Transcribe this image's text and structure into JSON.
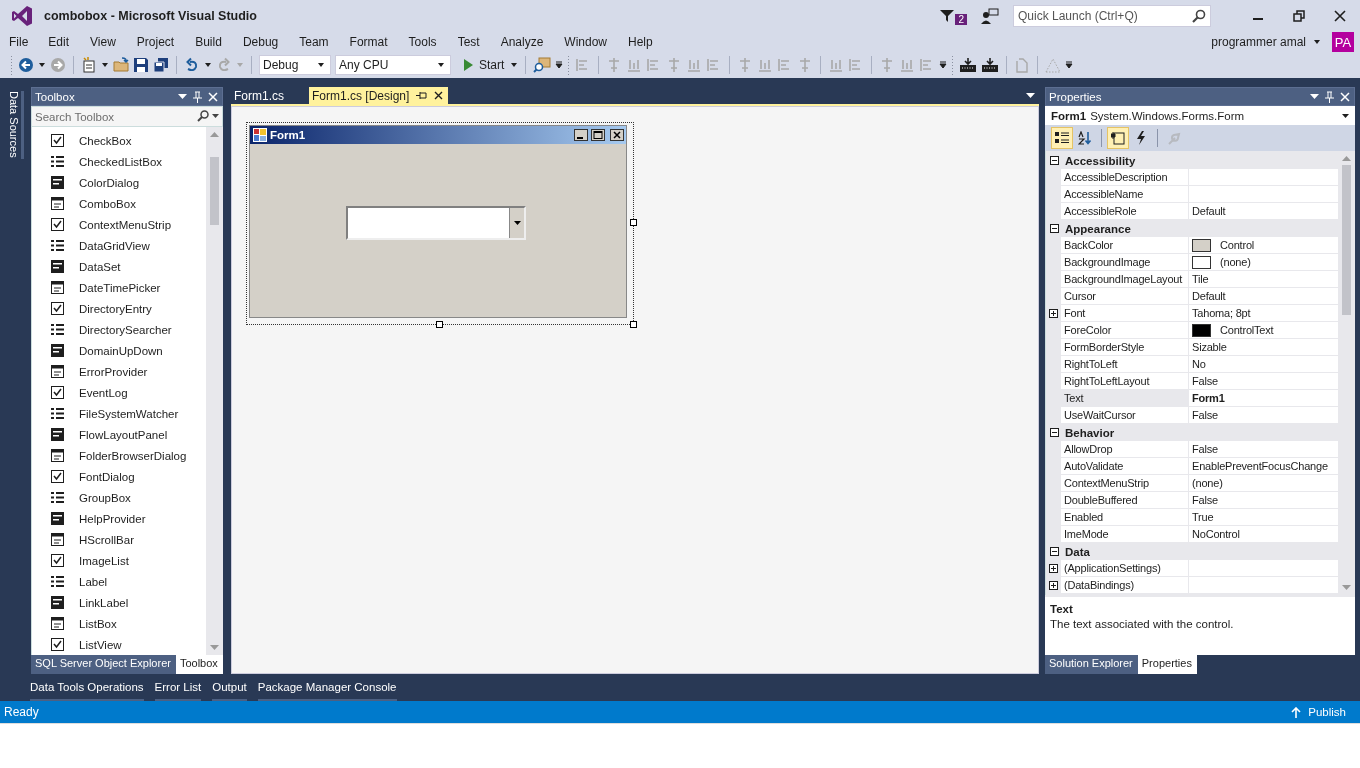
{
  "window": {
    "title": "combobox - Microsoft Visual Studio",
    "notification_count": "2",
    "quick_launch": {
      "placeholder": "Quick Launch (Ctrl+Q)"
    }
  },
  "menu": [
    "File",
    "Edit",
    "View",
    "Project",
    "Build",
    "Debug",
    "Team",
    "Format",
    "Tools",
    "Test",
    "Analyze",
    "Window",
    "Help"
  ],
  "account": {
    "name": "programmer amal",
    "initials": "PA"
  },
  "toolbar": {
    "configuration": "Debug",
    "platform": "Any CPU",
    "start": "Start"
  },
  "side_strip": {
    "label": "Data Sources"
  },
  "toolbox": {
    "title": "Toolbox",
    "search": {
      "placeholder": "Search Toolbox"
    },
    "items": [
      "CheckBox",
      "CheckedListBox",
      "ColorDialog",
      "ComboBox",
      "ContextMenuStrip",
      "DataGridView",
      "DataSet",
      "DateTimePicker",
      "DirectoryEntry",
      "DirectorySearcher",
      "DomainUpDown",
      "ErrorProvider",
      "EventLog",
      "FileSystemWatcher",
      "FlowLayoutPanel",
      "FolderBrowserDialog",
      "FontDialog",
      "GroupBox",
      "HelpProvider",
      "HScrollBar",
      "ImageList",
      "Label",
      "LinkLabel",
      "ListBox",
      "ListView"
    ],
    "tabs": [
      {
        "label": "SQL Server Object Explorer",
        "selected": false
      },
      {
        "label": "Toolbox",
        "selected": true
      }
    ]
  },
  "editor": {
    "tabs": [
      {
        "label": "Form1.cs",
        "selected": false
      },
      {
        "label": "Form1.cs [Design]",
        "selected": true
      }
    ],
    "form": {
      "title": "Form1"
    }
  },
  "properties": {
    "title": "Properties",
    "object": {
      "name": "Form1",
      "type": "System.Windows.Forms.Form"
    },
    "view_buttons": [
      {
        "kind": "categorized",
        "selected": true,
        "disabled": false
      },
      {
        "kind": "alphabetical",
        "selected": false,
        "disabled": false
      },
      {
        "kind": "properties",
        "selected": true,
        "disabled": false
      },
      {
        "kind": "events",
        "selected": false,
        "disabled": false
      },
      {
        "kind": "pages",
        "selected": false,
        "disabled": true
      }
    ],
    "rows": [
      {
        "kind": "category",
        "name": "Accessibility",
        "expanded": true
      },
      {
        "kind": "property",
        "name": "AccessibleDescription",
        "value": "",
        "selected": false
      },
      {
        "kind": "property",
        "name": "AccessibleName",
        "value": "",
        "selected": false
      },
      {
        "kind": "property",
        "name": "AccessibleRole",
        "value": "Default",
        "selected": false,
        "modified": false
      },
      {
        "kind": "category",
        "name": "Appearance",
        "expanded": true
      },
      {
        "kind": "property",
        "name": "BackColor",
        "value": "Control",
        "color": "#d4d0c8",
        "selected": false,
        "modified": false
      },
      {
        "kind": "property",
        "name": "BackgroundImage",
        "value": "(none)",
        "color": "#ffffff",
        "selected": false,
        "modified": false
      },
      {
        "kind": "property",
        "name": "BackgroundImageLayout",
        "value": "Tile",
        "selected": false,
        "modified": false
      },
      {
        "kind": "property",
        "name": "Cursor",
        "value": "Default",
        "selected": false,
        "modified": false
      },
      {
        "kind": "property",
        "name": "Font",
        "value": "Tahoma; 8pt",
        "expanded": false,
        "selected": false,
        "modified": false
      },
      {
        "kind": "property",
        "name": "ForeColor",
        "value": "ControlText",
        "color": "#000000",
        "selected": false,
        "modified": false
      },
      {
        "kind": "property",
        "name": "FormBorderStyle",
        "value": "Sizable",
        "selected": false,
        "modified": false
      },
      {
        "kind": "property",
        "name": "RightToLeft",
        "value": "No",
        "selected": false,
        "modified": false
      },
      {
        "kind": "property",
        "name": "RightToLeftLayout",
        "value": "False",
        "selected": false,
        "modified": false
      },
      {
        "kind": "property",
        "name": "Text",
        "value": "Form1",
        "selected": true,
        "modified": true
      },
      {
        "kind": "property",
        "name": "UseWaitCursor",
        "value": "False",
        "selected": false,
        "modified": false
      },
      {
        "kind": "category",
        "name": "Behavior",
        "expanded": true
      },
      {
        "kind": "property",
        "name": "AllowDrop",
        "value": "False",
        "selected": false,
        "modified": false
      },
      {
        "kind": "property",
        "name": "AutoValidate",
        "value": "EnablePreventFocusChange",
        "selected": false,
        "modified": false
      },
      {
        "kind": "property",
        "name": "ContextMenuStrip",
        "value": "(none)",
        "selected": false,
        "modified": false
      },
      {
        "kind": "property",
        "name": "DoubleBuffered",
        "value": "False",
        "selected": false,
        "modified": false
      },
      {
        "kind": "property",
        "name": "Enabled",
        "value": "True",
        "selected": false,
        "modified": false
      },
      {
        "kind": "property",
        "name": "ImeMode",
        "value": "NoControl",
        "selected": false,
        "modified": false
      },
      {
        "kind": "category",
        "name": "Data",
        "expanded": true
      },
      {
        "kind": "property",
        "name": "(ApplicationSettings)",
        "value": "",
        "expanded": false,
        "selected": false
      },
      {
        "kind": "property",
        "name": "(DataBindings)",
        "value": "",
        "expanded": false,
        "selected": false
      }
    ],
    "description": {
      "title": "Text",
      "text": "The text associated with the control."
    },
    "tabs": [
      {
        "label": "Solution Explorer",
        "selected": false
      },
      {
        "label": "Properties",
        "selected": true
      }
    ]
  },
  "tool_windows": [
    "Data Tools Operations",
    "Error List",
    "Output",
    "Package Manager Console"
  ],
  "status_bar": {
    "text": "Ready",
    "publish": "Publish"
  }
}
